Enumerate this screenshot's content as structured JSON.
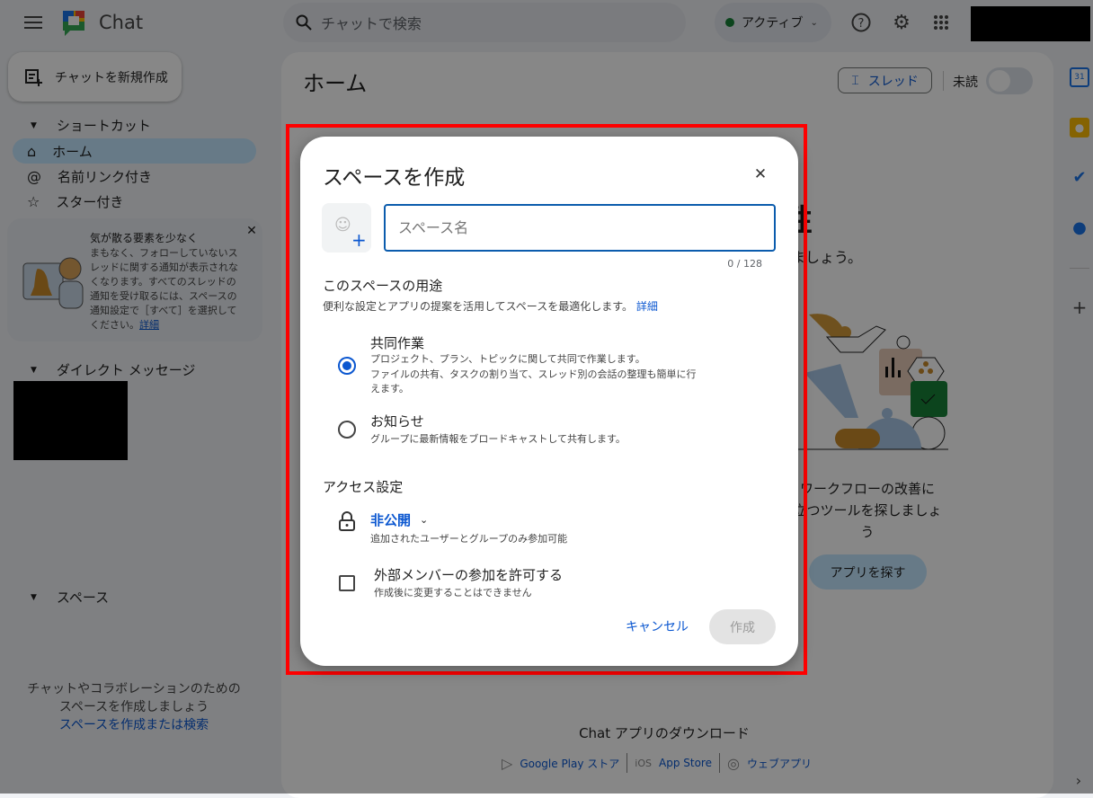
{
  "app": {
    "title": "Chat"
  },
  "topbar": {
    "search_placeholder": "チャットで検索",
    "status": "アクティブ",
    "icons": [
      "menu-icon",
      "help-icon",
      "settings-icon",
      "apps-grid-icon"
    ]
  },
  "sidebar": {
    "new_chat": "チャットを新規作成",
    "shortcuts_header": "ショートカット",
    "items": [
      {
        "label": "ホーム",
        "icon": "home-icon",
        "active": true
      },
      {
        "label": "名前リンク付き",
        "icon": "at-icon"
      },
      {
        "label": "スター付き",
        "icon": "star-icon"
      }
    ],
    "promo": {
      "title": "気が散る要素を少なく",
      "body": "まもなく、フォローしていないスレッドに関する通知が表示されなくなります。すべてのスレッドの通知を受け取るには、スペースの通知設定で［すべて］を選択してください。",
      "link": "詳細"
    },
    "dm_header": "ダイレクト メッセージ",
    "spaces_header": "スペース",
    "spaces_empty_line1": "チャットやコラボレーションのための",
    "spaces_empty_line2": "スペースを作成しましょう",
    "spaces_link": "スペースを作成または検索"
  },
  "main": {
    "title": "ホーム",
    "thread_button": "スレッド",
    "unread_label": "未読",
    "heading_fragment": "性",
    "subtitle_fragment": "ましょう。",
    "apps_text_line1": "ワークフローの改善に",
    "apps_text_line2": "立つツールを探しましょ",
    "apps_text_line3": "う",
    "find_apps": "アプリを探す",
    "download_title": "Chat アプリのダウンロード",
    "download_links": [
      "Google Play ストア",
      "App Store",
      "ウェブアプリ"
    ],
    "ios_label": "iOS"
  },
  "dialog": {
    "title": "スペースを作成",
    "name_placeholder": "スペース名",
    "name_value": "",
    "counter": "0 / 128",
    "purpose_heading": "このスペースの用途",
    "purpose_desc": "便利な設定とアプリの提案を活用してスペースを最適化します。",
    "purpose_link": "詳細",
    "options": [
      {
        "label": "共同作業",
        "desc": [
          "プロジェクト、プラン、トピックに関して共同で作業します。",
          "ファイルの共有、タスクの割り当て、スレッド別の会話の整理も簡単に行",
          "えます。"
        ],
        "selected": true
      },
      {
        "label": "お知らせ",
        "desc": [
          "グループに最新情報をブロードキャストして共有します。"
        ],
        "selected": false
      }
    ],
    "access_heading": "アクセス設定",
    "access_value": "非公開",
    "access_desc": "追加されたユーザーとグループのみ参加可能",
    "external_label": "外部メンバーの参加を許可する",
    "external_desc": "作成後に変更することはできません",
    "external_checked": false,
    "cancel": "キャンセル",
    "create": "作成"
  },
  "colors": {
    "accent": "#0b57d0",
    "highlight": "#ff0000",
    "active_status": "#188038"
  }
}
